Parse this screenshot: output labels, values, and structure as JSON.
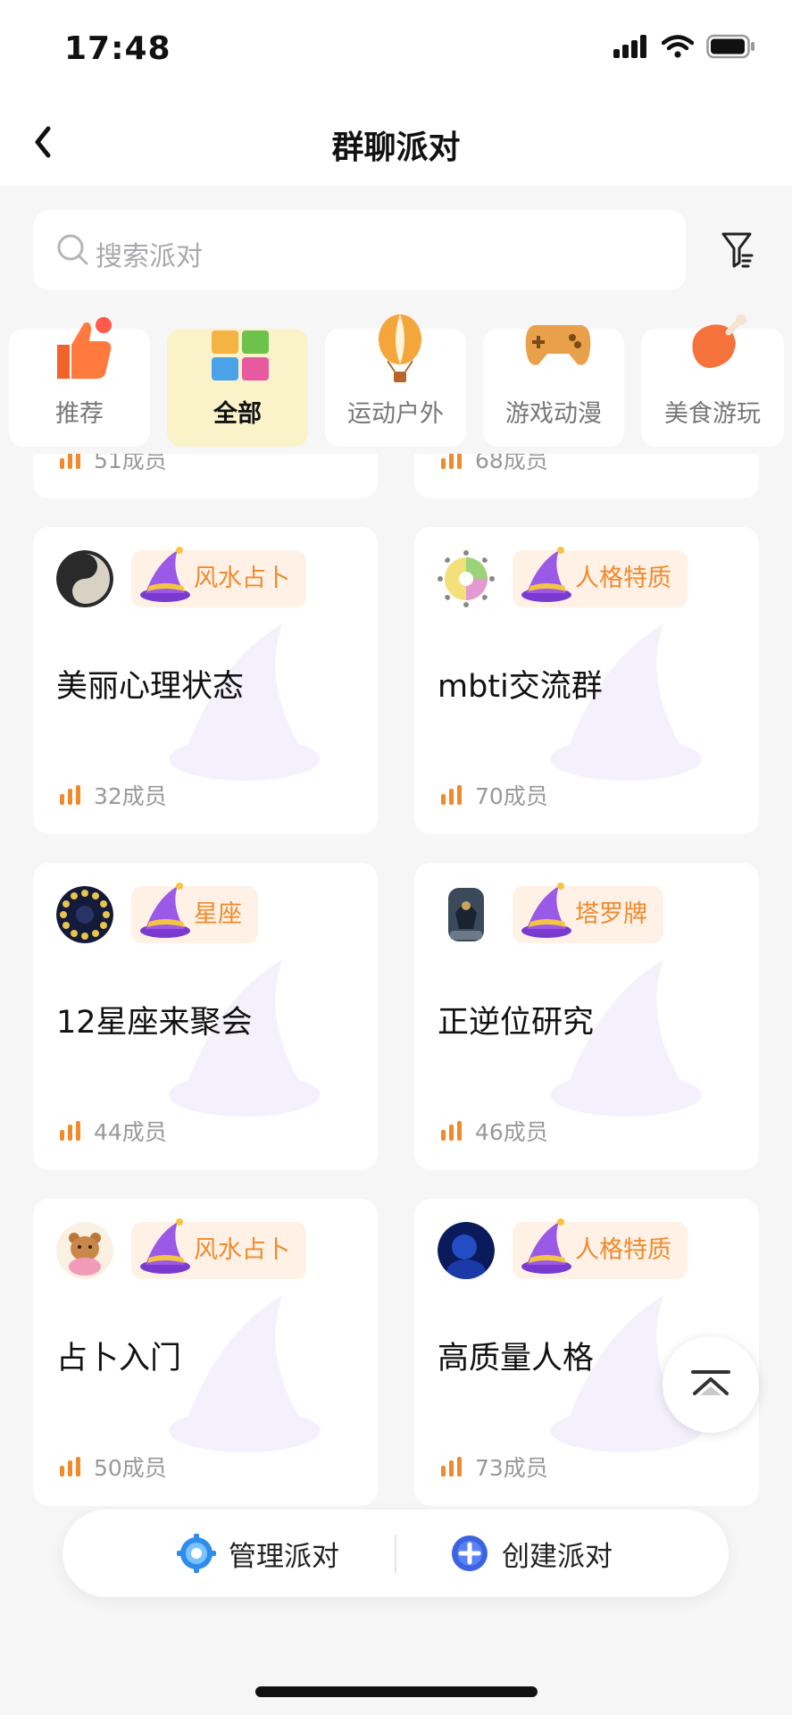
{
  "status": {
    "time": "17:48"
  },
  "header": {
    "title": "群聊派对"
  },
  "search": {
    "placeholder": "搜索派对"
  },
  "categories": [
    {
      "label": "推荐",
      "icon": "thumbs-up-icon"
    },
    {
      "label": "全部",
      "icon": "puzzle-icon",
      "selected": true
    },
    {
      "label": "运动户外",
      "icon": "hot-air-balloon-icon"
    },
    {
      "label": "游戏动漫",
      "icon": "gamepad-icon"
    },
    {
      "label": "美食游玩",
      "icon": "meat-leg-icon"
    }
  ],
  "partial_cards": [
    {
      "members": "51成员"
    },
    {
      "members": "68成员"
    }
  ],
  "cards": [
    {
      "tag": "风水占卜",
      "title": "美丽心理状态",
      "members": "32成员",
      "avatar": "yin-yang"
    },
    {
      "tag": "人格特质",
      "title": "mbti交流群",
      "members": "70成员",
      "avatar": "mbti-wheel"
    },
    {
      "tag": "星座",
      "title": "12星座来聚会",
      "members": "44成员",
      "avatar": "zodiac-wheel"
    },
    {
      "tag": "塔罗牌",
      "title": "正逆位研究",
      "members": "46成员",
      "avatar": "tarot-card"
    },
    {
      "tag": "风水占卜",
      "title": "占卜入门",
      "members": "50成员",
      "avatar": "bear"
    },
    {
      "tag": "人格特质",
      "title": "高质量人格",
      "members": "73成员",
      "avatar": "blue-portrait"
    }
  ],
  "bottom": {
    "manage": "管理派对",
    "create": "创建派对"
  },
  "colors": {
    "accent": "#f08a2c",
    "selected_category_bg": "#faf2c8",
    "tag_bg": "#fff1e6"
  }
}
